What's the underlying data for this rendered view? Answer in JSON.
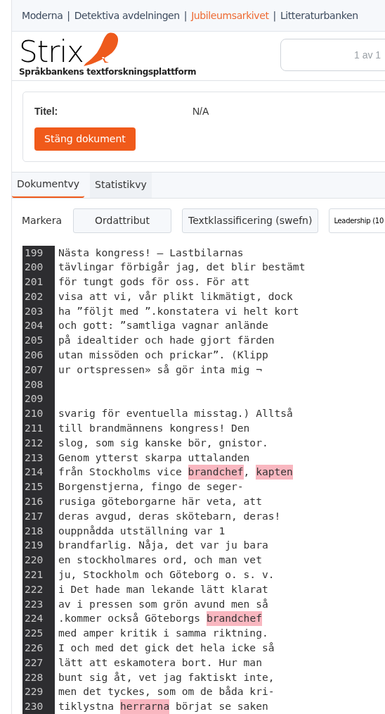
{
  "nav": [
    {
      "kind": "link",
      "label": "Moderna",
      "selected": false
    },
    {
      "kind": "separator",
      "label": "|"
    },
    {
      "kind": "link",
      "label": "Detektiva avdelningen",
      "selected": false
    },
    {
      "kind": "separator",
      "label": "|"
    },
    {
      "kind": "link",
      "label": "Jubileumsarkivet",
      "selected": true
    },
    {
      "kind": "separator",
      "label": "|"
    },
    {
      "kind": "link",
      "label": "Litteraturbanken",
      "selected": false
    }
  ],
  "logo": {
    "name": "Strix",
    "subtitle": "Språkbankens textforskningsplattform"
  },
  "search": {
    "value": "1 av 1"
  },
  "document": {
    "title_label": "Titel:",
    "title_value": "N/A",
    "close_button": "Stäng dokument"
  },
  "tabs": [
    {
      "label": "Dokumentvy",
      "selected": true
    },
    {
      "label": "Statistikvy",
      "selected": false
    }
  ],
  "toolbar": {
    "label": "Markera",
    "buttons": [
      "Ordattribut",
      "Textklassificering (swefn)"
    ],
    "select": "Leadership (10"
  },
  "lines": [
    {
      "number": "199",
      "segments": [
        {
          "text": "Nästa kongress! — Lastbilarnas",
          "highlighted": false
        }
      ]
    },
    {
      "number": "200",
      "segments": [
        {
          "text": "tävlingar förbigår jag, det blir bestämt",
          "highlighted": false
        }
      ]
    },
    {
      "number": "201",
      "segments": [
        {
          "text": "för tungt gods för oss. För att",
          "highlighted": false
        }
      ]
    },
    {
      "number": "202",
      "segments": [
        {
          "text": "visa att vi, vår plikt likmätigt, dock",
          "highlighted": false
        }
      ]
    },
    {
      "number": "203",
      "segments": [
        {
          "text": "ha ”följt med ”.konstatera vi helt kort",
          "highlighted": false
        }
      ]
    },
    {
      "number": "204",
      "segments": [
        {
          "text": "och gott: ”samtliga vagnar anlände",
          "highlighted": false
        }
      ]
    },
    {
      "number": "205",
      "segments": [
        {
          "text": "på idealtider och hade gjort färden",
          "highlighted": false
        }
      ]
    },
    {
      "number": "206",
      "segments": [
        {
          "text": "utan missöden och prickar”. (Klipp",
          "highlighted": false
        }
      ]
    },
    {
      "number": "207",
      "segments": [
        {
          "text": "ur ortspressen» så gör inta mig ¬",
          "highlighted": false
        }
      ]
    },
    {
      "number": "208"
    },
    {
      "number": "209"
    },
    {
      "number": "210",
      "segments": [
        {
          "text": "svarig för eventuella misstag.) Alltså",
          "highlighted": false
        }
      ]
    },
    {
      "number": "211",
      "segments": [
        {
          "text": "till brandmännens kongress! Den",
          "highlighted": false
        }
      ]
    },
    {
      "number": "212",
      "segments": [
        {
          "text": "slog, som sig kanske bör, gnistor.",
          "highlighted": false
        }
      ]
    },
    {
      "number": "213",
      "segments": [
        {
          "text": "Genom ytterst skarpa uttalanden",
          "highlighted": false
        }
      ]
    },
    {
      "number": "214",
      "segments": [
        {
          "text": "från Stockholms vice ",
          "highlighted": false
        },
        {
          "text": "brandchef",
          "highlighted": true
        },
        {
          "text": ", ",
          "highlighted": false
        },
        {
          "text": "kapten",
          "highlighted": true
        }
      ]
    },
    {
      "number": "215",
      "segments": [
        {
          "text": "Borgenstjerna, fingo de seger-",
          "highlighted": false
        }
      ]
    },
    {
      "number": "216",
      "segments": [
        {
          "text": "rusiga göteborgarne här veta, att",
          "highlighted": false
        }
      ]
    },
    {
      "number": "217",
      "segments": [
        {
          "text": "deras avgud, deras skötebarn, deras!",
          "highlighted": false
        }
      ]
    },
    {
      "number": "218",
      "segments": [
        {
          "text": "ouppnådda utställning var 1",
          "highlighted": false
        }
      ]
    },
    {
      "number": "219",
      "segments": [
        {
          "text": "brandfarlig. Nåja, det var ju bara",
          "highlighted": false
        }
      ]
    },
    {
      "number": "220",
      "segments": [
        {
          "text": "en stockholmares ord, och man vet",
          "highlighted": false
        }
      ]
    },
    {
      "number": "221",
      "segments": [
        {
          "text": "ju, Stockholm och Göteborg o. s. v.",
          "highlighted": false
        }
      ]
    },
    {
      "number": "222",
      "segments": [
        {
          "text": "i Det hade man lekande lätt klarat",
          "highlighted": false
        }
      ]
    },
    {
      "number": "223",
      "segments": [
        {
          "text": "av i pressen som grön avund men så",
          "highlighted": false
        }
      ]
    },
    {
      "number": "224",
      "segments": [
        {
          "text": ".kommer också Göteborgs ",
          "highlighted": false
        },
        {
          "text": "brandchef",
          "highlighted": true
        }
      ]
    },
    {
      "number": "225",
      "segments": [
        {
          "text": "med amper kritik i samma riktning.",
          "highlighted": false
        }
      ]
    },
    {
      "number": "226",
      "segments": [
        {
          "text": "I och med det gick det hela icke så",
          "highlighted": false
        }
      ]
    },
    {
      "number": "227",
      "segments": [
        {
          "text": "lätt att eskamotera bort. Hur man",
          "highlighted": false
        }
      ]
    },
    {
      "number": "228",
      "segments": [
        {
          "text": "bunt sig åt, vet jag faktiskt inte,",
          "highlighted": false
        }
      ]
    },
    {
      "number": "229",
      "segments": [
        {
          "text": "men det tyckes, som om de båda kri-",
          "highlighted": false
        }
      ]
    },
    {
      "number": "230",
      "segments": [
        {
          "text": "tiklystna ",
          "highlighted": false
        },
        {
          "text": "herrarna",
          "highlighted": true
        },
        {
          "text": " börjat se saken",
          "highlighted": false
        }
      ]
    }
  ]
}
